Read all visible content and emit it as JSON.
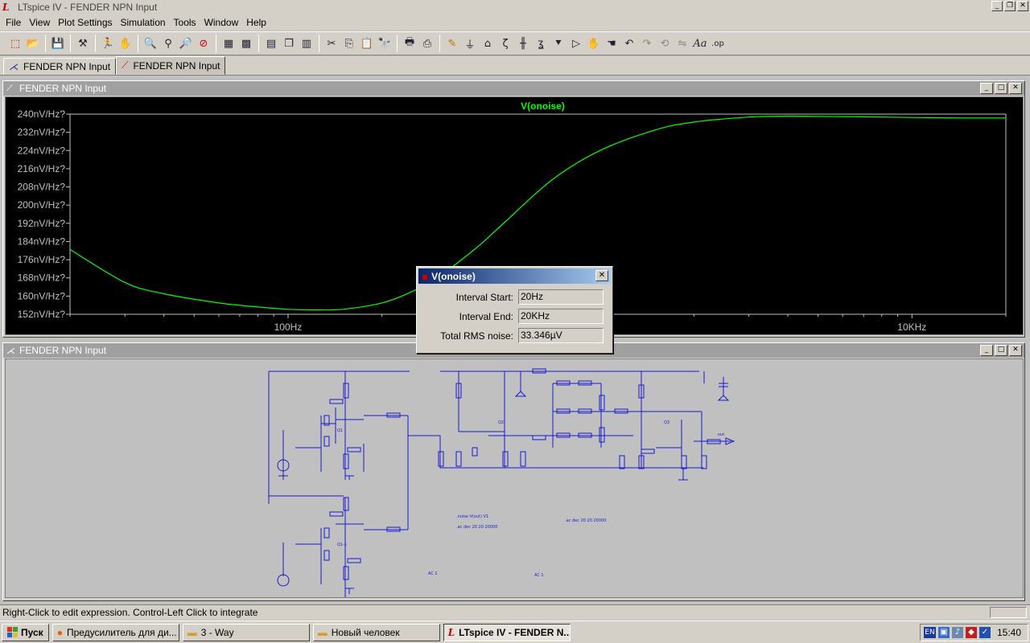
{
  "window": {
    "title": "LTspice IV - FENDER NPN Input"
  },
  "menu": [
    "File",
    "View",
    "Plot Settings",
    "Simulation",
    "Tools",
    "Window",
    "Help"
  ],
  "tabs": [
    {
      "label": "FENDER NPN Input",
      "icon": "schematic-icon"
    },
    {
      "label": "FENDER NPN Input",
      "icon": "waveform-icon",
      "active": true
    }
  ],
  "plot_window": {
    "title": "FENDER NPN Input"
  },
  "schematic_window": {
    "title": "FENDER NPN Input"
  },
  "chart_data": {
    "type": "line",
    "title": "V(onoise)",
    "series": [
      {
        "name": "V(onoise)",
        "color": "#00ff00",
        "x": [
          20,
          30,
          40,
          60,
          80,
          100,
          120,
          150,
          200,
          250,
          300,
          400,
          500,
          700,
          1000,
          1500,
          2000,
          3000,
          4000,
          5000,
          7000,
          10000,
          15000,
          20000
        ],
        "y": [
          180.5,
          166,
          161,
          157,
          155.2,
          154.2,
          153.9,
          154.2,
          157,
          162,
          168,
          181,
          193,
          211,
          224,
          233,
          236.5,
          238.7,
          239.1,
          239.0,
          238.8,
          238.5,
          238.3,
          238.3
        ]
      }
    ],
    "xscale": "log",
    "xlim": [
      20,
      20000
    ],
    "ylim": [
      152,
      240
    ],
    "xticks": [
      {
        "value": 100,
        "label": "100Hz"
      },
      {
        "value": 10000,
        "label": "10KHz"
      }
    ],
    "yticks": [
      {
        "value": 240,
        "label": "240nV/Hz?"
      },
      {
        "value": 232,
        "label": "232nV/Hz?"
      },
      {
        "value": 224,
        "label": "224nV/Hz?"
      },
      {
        "value": 216,
        "label": "216nV/Hz?"
      },
      {
        "value": 208,
        "label": "208nV/Hz?"
      },
      {
        "value": 200,
        "label": "200nV/Hz?"
      },
      {
        "value": 192,
        "label": "192nV/Hz?"
      },
      {
        "value": 184,
        "label": "184nV/Hz?"
      },
      {
        "value": 176,
        "label": "176nV/Hz?"
      },
      {
        "value": 168,
        "label": "168nV/Hz?"
      },
      {
        "value": 160,
        "label": "160nV/Hz?"
      },
      {
        "value": 152,
        "label": "152nV/Hz?"
      }
    ],
    "grid": false,
    "background": "#000000",
    "axis_color": "#c0c0c0"
  },
  "dialog": {
    "title": "V(onoise)",
    "rows": [
      {
        "label": "Interval Start:",
        "value": "20Hz"
      },
      {
        "label": "Interval End:",
        "value": "20KHz"
      },
      {
        "label": "Total RMS noise:",
        "value": "33.346µV"
      }
    ]
  },
  "status": {
    "text": "Right-Click to edit expression. Control-Left Click to integrate"
  },
  "taskbar": {
    "start": "Пуск",
    "tasks": [
      {
        "label": "Предусилитель для ди...",
        "icon": "browser-icon"
      },
      {
        "label": "3 - Way",
        "icon": "folder-icon"
      },
      {
        "label": "Новый человек",
        "icon": "folder-icon"
      },
      {
        "label": "LTspice IV - FENDER N...",
        "icon": "ltspice-icon",
        "active": true
      }
    ],
    "tray": {
      "lang": "EN",
      "time": "15:40"
    }
  }
}
